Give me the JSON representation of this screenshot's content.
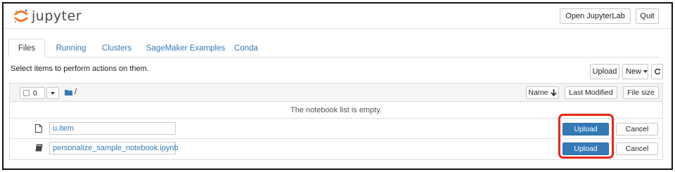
{
  "header": {
    "logo_text": "jupyter",
    "open_jupyterlab_label": "Open JupyterLab",
    "quit_label": "Quit"
  },
  "tabs": [
    {
      "label": "Files",
      "active": true
    },
    {
      "label": "Running",
      "active": false
    },
    {
      "label": "Clusters",
      "active": false
    },
    {
      "label": "SageMaker Examples",
      "active": false
    },
    {
      "label": "Conda",
      "active": false
    }
  ],
  "toolbar": {
    "instructions": "Select items to perform actions on them.",
    "upload_label": "Upload",
    "new_label": "New",
    "refresh_icon": "refresh-icon"
  },
  "list_header": {
    "selected_count": "0",
    "path": "/",
    "sort_name_label": "Name",
    "sort_last_modified_label": "Last Modified",
    "sort_size_label": "File size"
  },
  "empty_message": "The notebook list is empty.",
  "pending_uploads": [
    {
      "filename": "u.item",
      "icon": "file-icon",
      "upload_label": "Upload",
      "cancel_label": "Cancel"
    },
    {
      "filename": "personalize_sample_notebook.ipynb",
      "icon": "notebook-icon",
      "upload_label": "Upload",
      "cancel_label": "Cancel"
    }
  ],
  "colors": {
    "accent": "#337ab7",
    "logo_orange": "#f37726",
    "highlight": "#e8261a"
  }
}
